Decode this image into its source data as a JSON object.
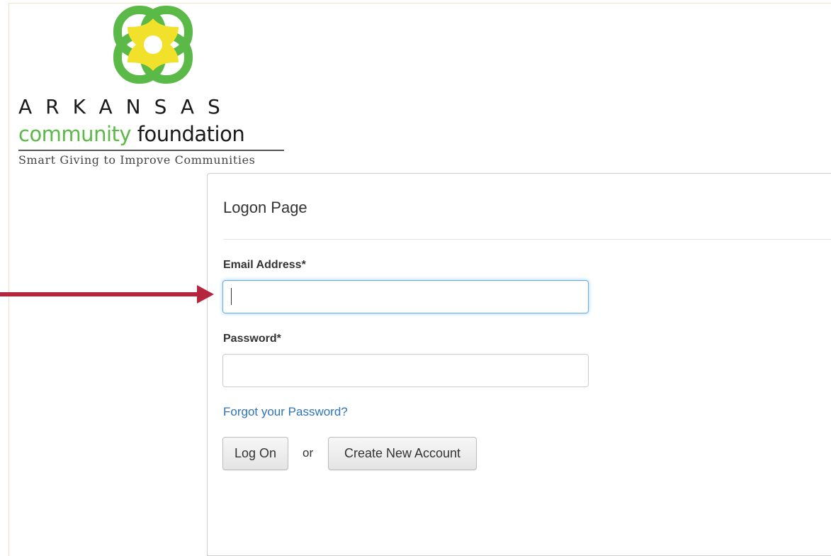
{
  "logo": {
    "brand_word": "ARKANSAS",
    "line2_community": "community",
    "line2_foundation": "foundation",
    "tagline": "Smart Giving to Improve Communities"
  },
  "panel": {
    "title": "Logon Page",
    "email_label": "Email Address*",
    "email_value": "",
    "password_label": "Password*",
    "password_value": "",
    "forgot_link": "Forgot your Password?",
    "logon_button": "Log On",
    "or_text": "or",
    "create_button": "Create New Account"
  },
  "colors": {
    "accent_arrow": "#b5263c",
    "link": "#2f73b7",
    "logo_green": "#5bb947",
    "logo_yellow": "#f2e12b",
    "focus_border": "#66afe9"
  },
  "icons": {
    "logo_mark": "interlocking-rings-logo",
    "annotation": "red-arrow-pointer"
  }
}
